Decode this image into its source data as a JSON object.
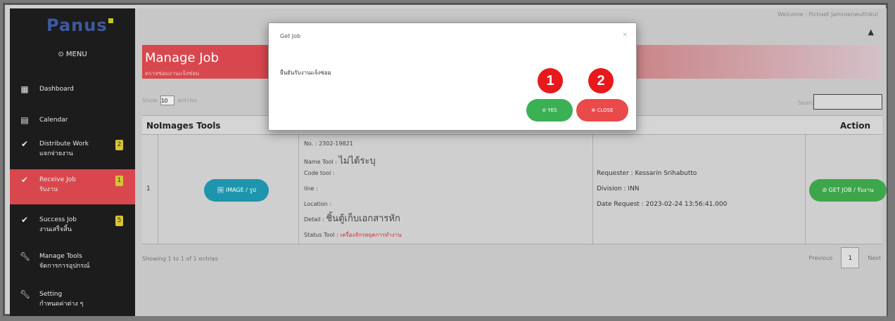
{
  "app": {
    "logo_text": "Panus",
    "welcome": "Welcome : Pichaet Jamroenwuthikul",
    "user_icon": "user-icon"
  },
  "sidebar": {
    "menu_label": "⊙ MENU",
    "items": [
      {
        "label": "Dashboard",
        "sub": "",
        "badge": "",
        "icon": "grid-icon"
      },
      {
        "label": "Calendar",
        "sub": "",
        "badge": "",
        "icon": "calendar-icon"
      },
      {
        "label": "Distribute Work",
        "sub": "แจกจ่ายงาน",
        "badge": "2",
        "icon": "check-icon"
      },
      {
        "label": "Receive Job",
        "sub": "รับงาน",
        "badge": "1",
        "icon": "check-icon",
        "active": true
      },
      {
        "label": "Success Job",
        "sub": "งานเสร็จสิ้น",
        "badge": "5",
        "icon": "check-icon"
      },
      {
        "label": "Manage Tools",
        "sub": "จัดการการอุปกรณ์",
        "badge": "",
        "icon": "wrench-icon"
      },
      {
        "label": "Setting",
        "sub": "กำหนดค่าต่าง ๆ",
        "badge": "",
        "icon": "wrench-icon"
      }
    ]
  },
  "page": {
    "title": "Manage Job",
    "subtitle": "ตรวจซ่อมงานแจ้งซ่อม",
    "show_prefix": "Show",
    "show_value": "10",
    "show_suffix": "entries",
    "search_label": "Search:",
    "showing_text": "Showing 1 to 1 of 1 entries",
    "pager": {
      "prev": "Previous",
      "page": "1",
      "next": "Next"
    }
  },
  "table": {
    "headers": {
      "no": "No.",
      "images": "Images Tools",
      "action": "Action"
    },
    "row": {
      "no": "1",
      "image_btn": "🖼 IMAGE / รูป",
      "details": {
        "no_line": "No. : 2302-19821",
        "name_prefix": "Name Tool : ",
        "name_value": "ไม่ได้ระบุ",
        "code": "Code tool :",
        "line": "line :",
        "location": "Location :",
        "detail_prefix": "Detail : ",
        "detail_value": "ชิ้นตู้เก็บเอกสารหัก",
        "status_prefix": "Status Tool : ",
        "status_value": "เครื่องจักรหยุดการทำงาน"
      },
      "requester": "Requester : Kessarin Srihabutto",
      "division": "Division : INN",
      "date": "Date Request : 2023-02-24 13:56:41.000",
      "get_job_btn": "⊘ GET JOB / รับงาน"
    }
  },
  "modal": {
    "title": "Get Job",
    "close_x": "×",
    "message": "ยืนยันรับงานแจ้งซ่อม",
    "yes_label": "⊘ YES",
    "close_label": "⊗ CLOSE",
    "marker_1": "1",
    "marker_2": "2"
  },
  "colors": {
    "accent_red": "#d9474e",
    "yes_green": "#3cb054",
    "close_red": "#ea4a4a",
    "info_teal": "#1e95ad",
    "badge_yellow": "#d8c335"
  }
}
